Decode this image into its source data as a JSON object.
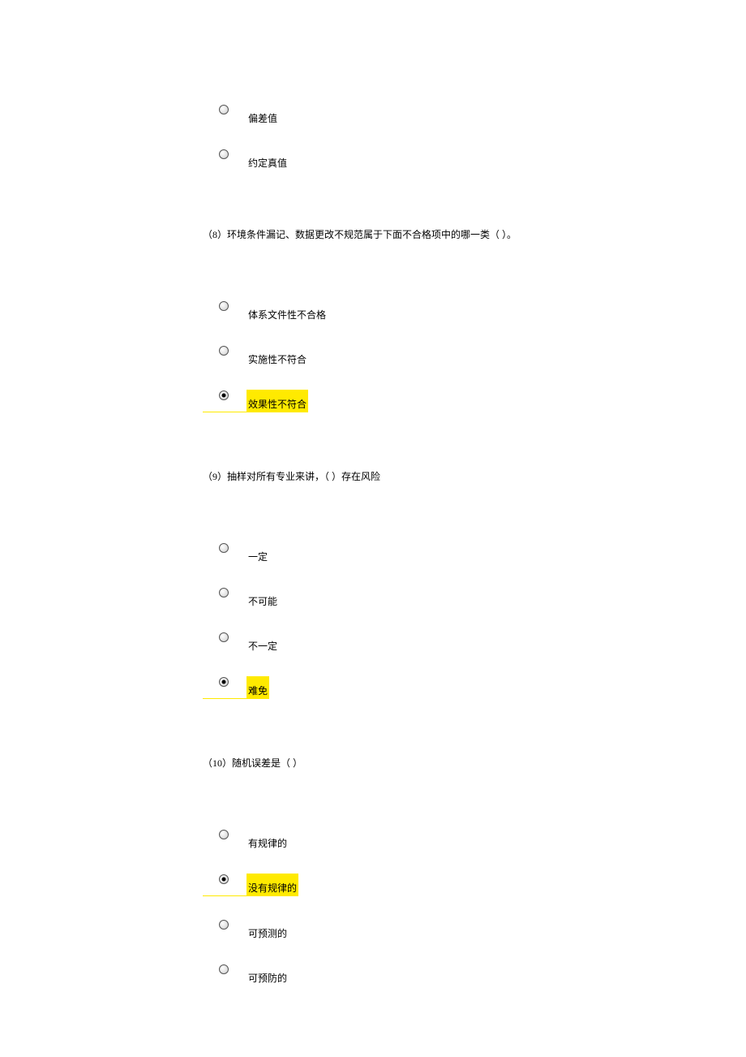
{
  "q7": {
    "options": [
      {
        "label": "偏差值",
        "selected": false
      },
      {
        "label": "约定真值",
        "selected": false
      }
    ]
  },
  "q8": {
    "prompt": "（8）环境条件漏记、数据更改不规范属于下面不合格项中的哪一类（ ）。",
    "options": [
      {
        "label": "体系文件性不合格",
        "selected": false
      },
      {
        "label": "实施性不符合",
        "selected": false
      },
      {
        "label": "效果性不符合",
        "selected": true
      }
    ]
  },
  "q9": {
    "prompt": "（9）抽样对所有专业来讲，（ ）存在风险",
    "options": [
      {
        "label": "一定",
        "selected": false
      },
      {
        "label": "不可能",
        "selected": false
      },
      {
        "label": "不一定",
        "selected": false
      },
      {
        "label": "难免",
        "selected": true
      }
    ]
  },
  "q10": {
    "prompt": "（10）随机误差是（ ）",
    "options": [
      {
        "label": "有规律的",
        "selected": false
      },
      {
        "label": "没有规律的",
        "selected": true
      },
      {
        "label": "可预测的",
        "selected": false
      },
      {
        "label": "可预防的",
        "selected": false
      }
    ]
  }
}
